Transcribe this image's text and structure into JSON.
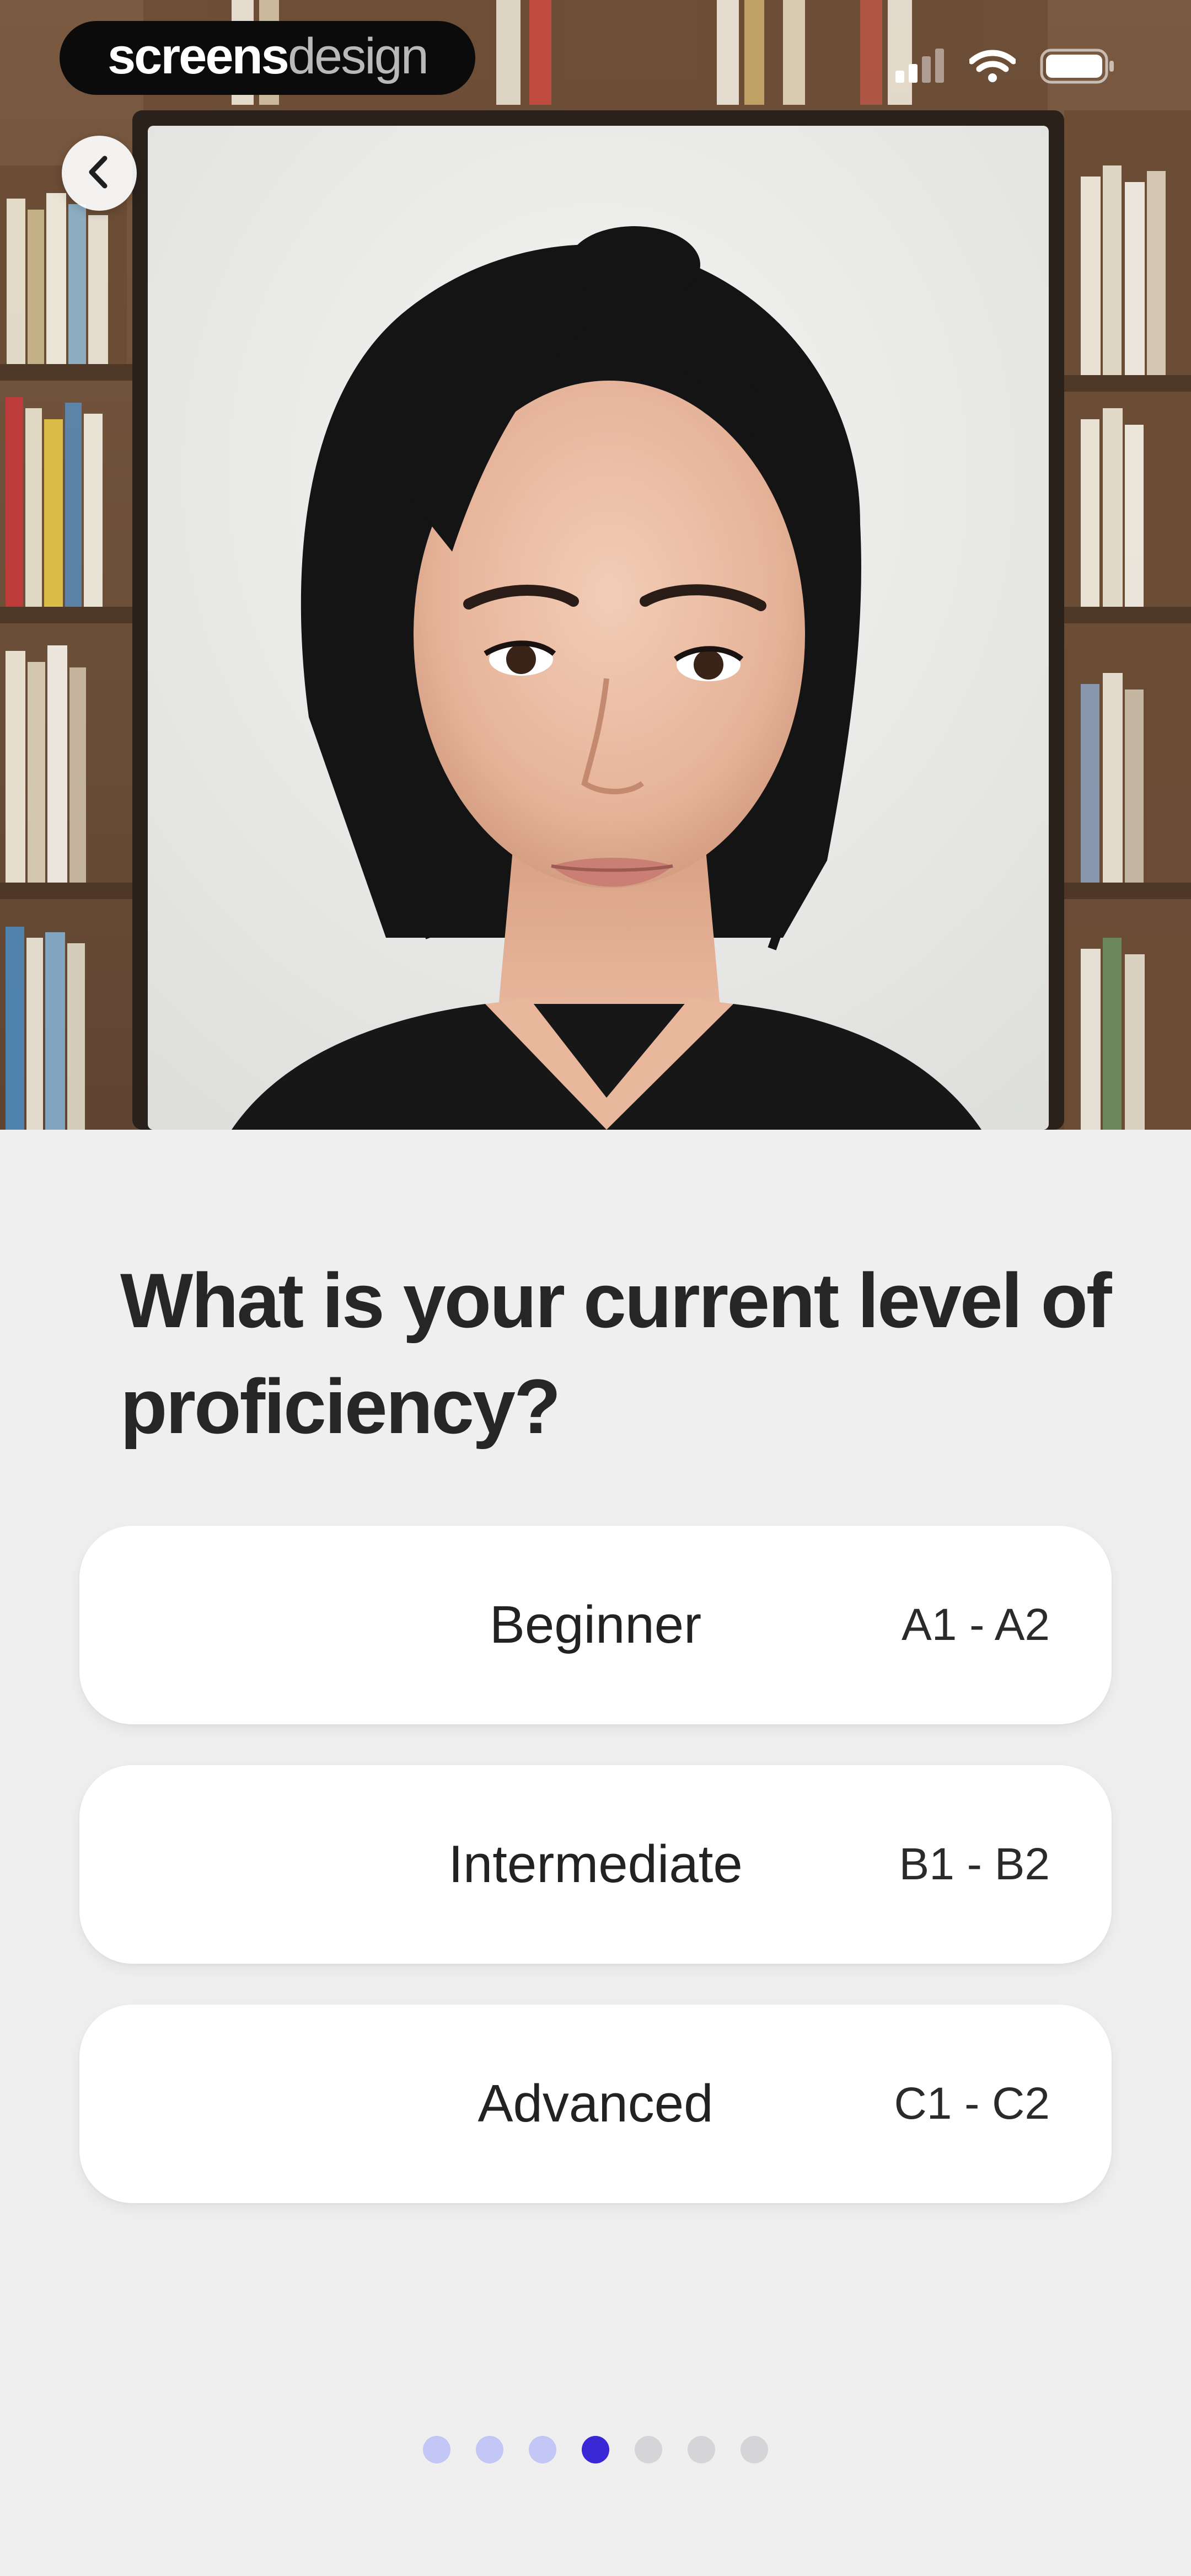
{
  "status_bar": {
    "brand_primary": "screens",
    "brand_secondary": "design"
  },
  "hero": {
    "alt": "tutor portrait"
  },
  "back_button": {
    "icon": "chevron-left-icon"
  },
  "question": {
    "text": "What is your current level of proficiency?"
  },
  "options": [
    {
      "label": "Beginner",
      "code": "A1 - A2"
    },
    {
      "label": "Intermediate",
      "code": "B1 - B2"
    },
    {
      "label": "Advanced",
      "code": "C1 - C2"
    }
  ],
  "pagination": {
    "total": 7,
    "current_index": 3,
    "colors": {
      "completed": "#c3c7f6",
      "active": "#3a27d6",
      "upcoming": "#d5d5d8"
    }
  },
  "colors": {
    "background": "#efeff0",
    "card": "#ffffff",
    "text": "#262626"
  }
}
